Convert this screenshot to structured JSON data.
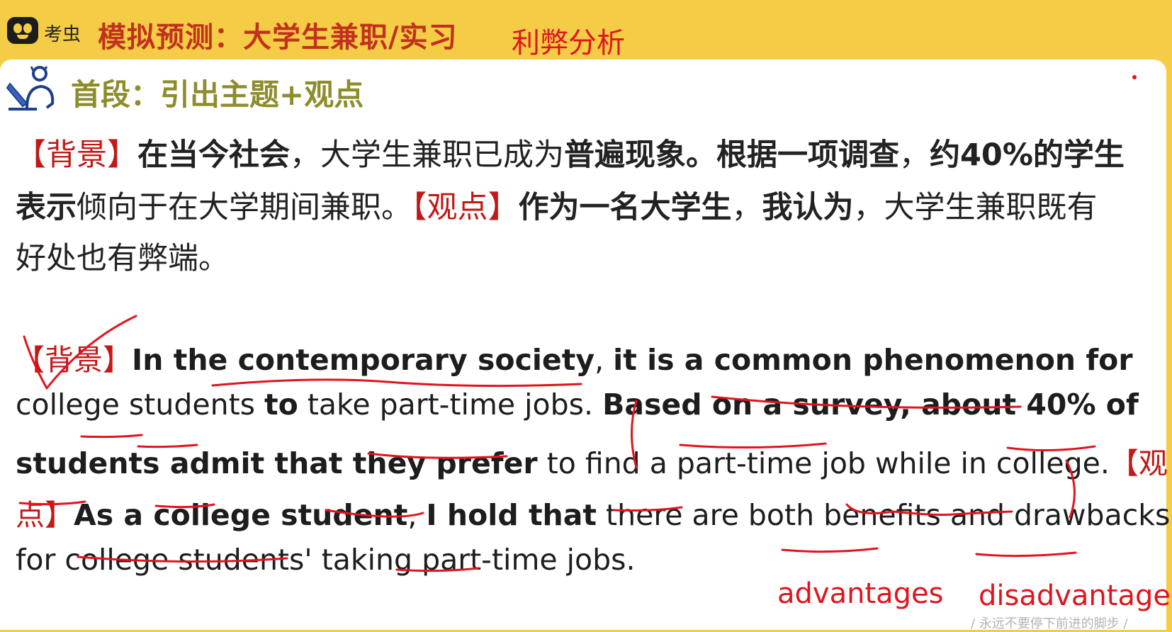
{
  "header": {
    "logo_text": "考虫",
    "title": "模拟预测：大学生兼职/实习",
    "handwritten_title": "利弊分析"
  },
  "section": {
    "title": "首段：引出主题+观点"
  },
  "chinese": {
    "line1": [
      {
        "text": "【背景】",
        "style": "tag"
      },
      {
        "text": "在当今社会",
        "style": "bold"
      },
      {
        "text": "，大学生兼职已成为",
        "style": "normal"
      },
      {
        "text": "普遍现象。根据一项调查",
        "style": "bold"
      },
      {
        "text": "，",
        "style": "normal"
      },
      {
        "text": "约40%的学生",
        "style": "bold"
      }
    ],
    "line2": [
      {
        "text": "表示",
        "style": "bold"
      },
      {
        "text": "倾向于在大学期间兼职。",
        "style": "normal"
      },
      {
        "text": "【观点】",
        "style": "tag"
      },
      {
        "text": "作为一名大学生",
        "style": "bold"
      },
      {
        "text": "，",
        "style": "normal"
      },
      {
        "text": "我认为",
        "style": "bold"
      },
      {
        "text": "，大学生兼职既有",
        "style": "normal"
      }
    ],
    "line3": [
      {
        "text": "好处也有弊端。",
        "style": "normal"
      }
    ]
  },
  "english": {
    "line1": [
      {
        "text": "【背景】",
        "style": "tag"
      },
      {
        "text": "In the contemporary society",
        "style": "bold"
      },
      {
        "text": ", ",
        "style": "normal"
      },
      {
        "text": "it is a common phenomenon for",
        "style": "bold"
      }
    ],
    "line2": [
      {
        "text": "college students ",
        "style": "normal"
      },
      {
        "text": "to",
        "style": "bold"
      },
      {
        "text": " take part-time jobs. ",
        "style": "normal"
      },
      {
        "text": "Based on a survey, about 40% of",
        "style": "bold"
      }
    ],
    "line3": [
      {
        "text": "students admit that they prefer",
        "style": "bold"
      },
      {
        "text": " to find a part-time job while in college.",
        "style": "normal"
      },
      {
        "text": "【观",
        "style": "tag"
      }
    ],
    "line4": [
      {
        "text": "点】",
        "style": "tag"
      },
      {
        "text": "As a college student",
        "style": "bold"
      },
      {
        "text": ", ",
        "style": "normal"
      },
      {
        "text": "I hold that",
        "style": "bold"
      },
      {
        "text": " there are both benefits and drawbacks",
        "style": "normal"
      }
    ],
    "line5": [
      {
        "text": "for college students' taking part-time jobs.",
        "style": "normal"
      }
    ]
  },
  "annotations": {
    "advantages": "advantages",
    "disadvantages": "disadvantages"
  },
  "footer": {
    "text": "/ 永远不要停下前进的脚步 /"
  },
  "colors": {
    "header_bg": "#f4cc45",
    "title_red": "#c0321c",
    "tag_red": "#c21818",
    "annotation_red": "#e1141e",
    "section_olive": "#8d8d2c"
  }
}
